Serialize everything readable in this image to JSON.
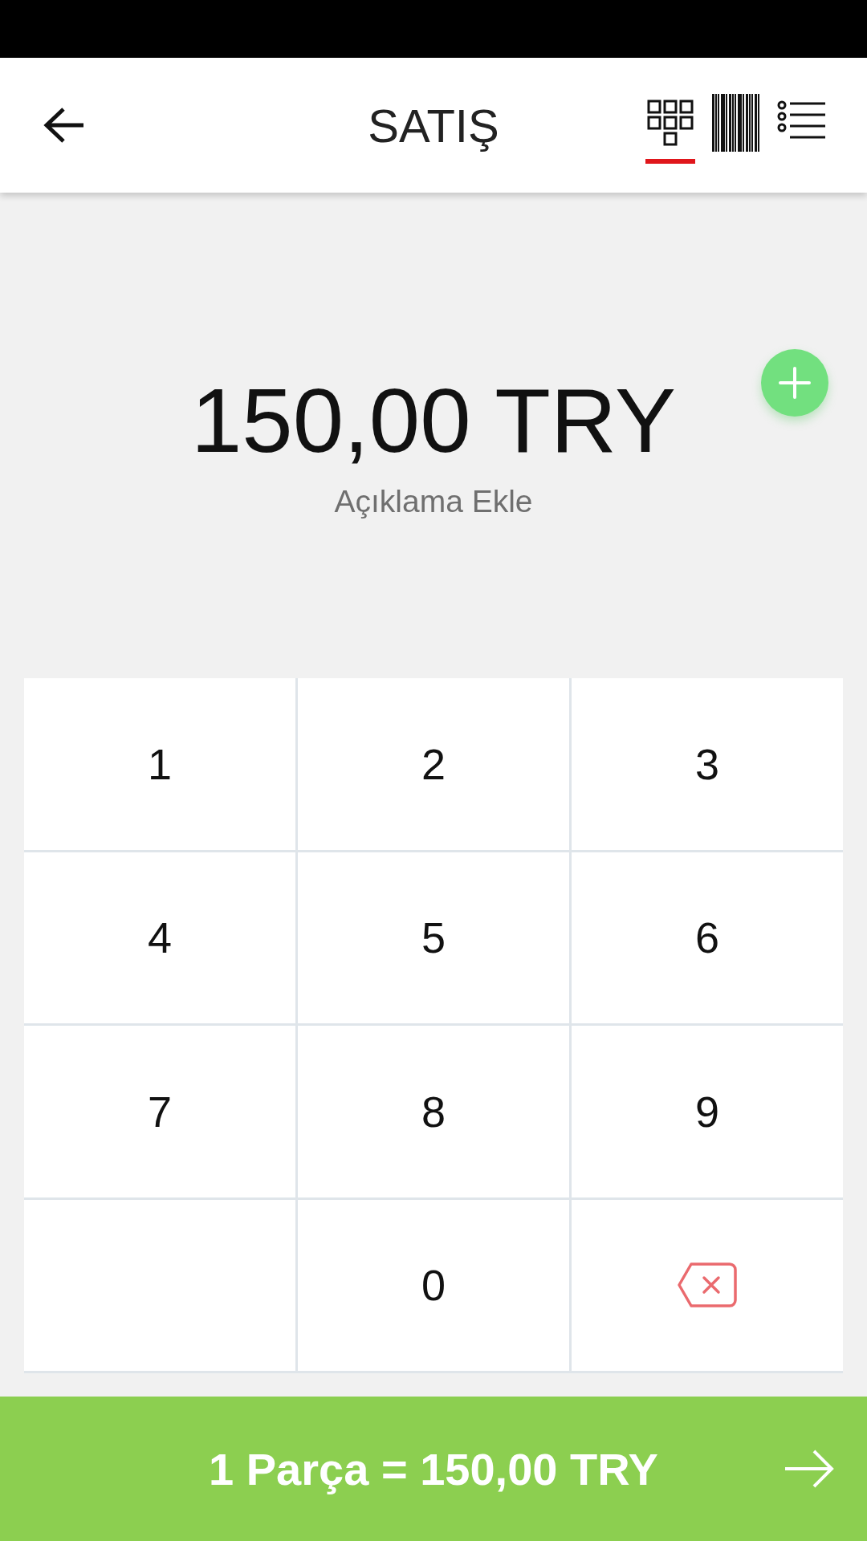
{
  "header": {
    "title": "SATIŞ"
  },
  "view_tabs": [
    {
      "kind": "keypad",
      "selected": true
    },
    {
      "kind": "barcode",
      "selected": false
    },
    {
      "kind": "list",
      "selected": false
    }
  ],
  "amount": "150,00 TRY",
  "description_placeholder": "Açıklama Ekle",
  "keys": [
    {
      "kind": "digit",
      "label": "1"
    },
    {
      "kind": "digit",
      "label": "2"
    },
    {
      "kind": "digit",
      "label": "3"
    },
    {
      "kind": "digit",
      "label": "4"
    },
    {
      "kind": "digit",
      "label": "5"
    },
    {
      "kind": "digit",
      "label": "6"
    },
    {
      "kind": "digit",
      "label": "7"
    },
    {
      "kind": "digit",
      "label": "8"
    },
    {
      "kind": "digit",
      "label": "9"
    },
    {
      "kind": "empty"
    },
    {
      "kind": "digit",
      "label": "0"
    },
    {
      "kind": "backspace"
    }
  ],
  "checkout_button": "1 Parça = 150,00 TRY"
}
